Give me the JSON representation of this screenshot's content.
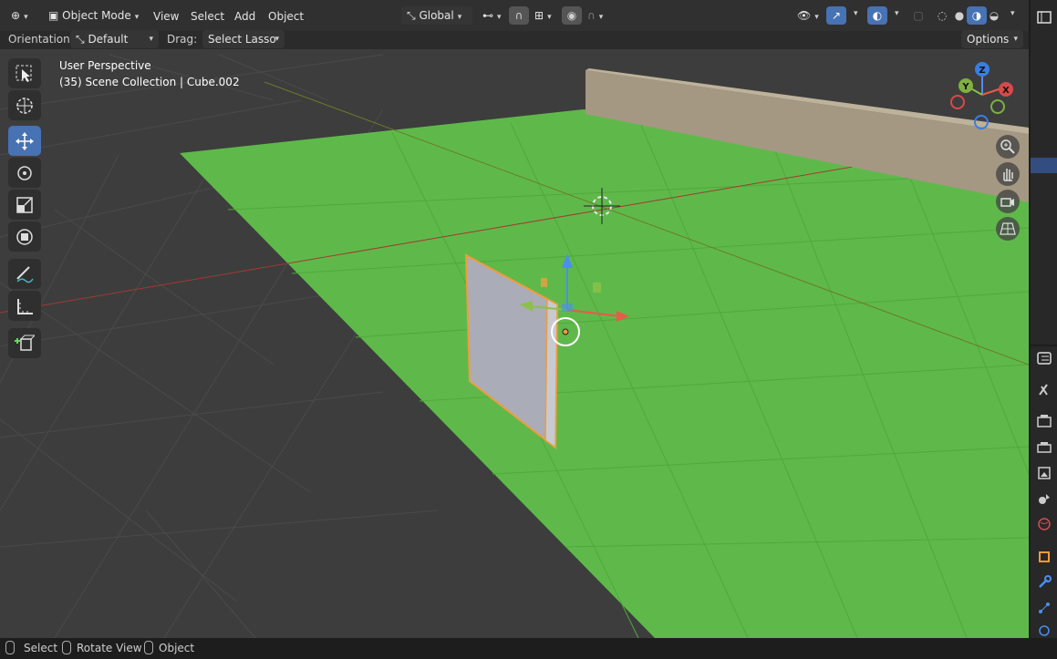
{
  "header": {
    "mode": "Object Mode",
    "menus": [
      "View",
      "Select",
      "Add",
      "Object"
    ],
    "transform_orientation": "Global"
  },
  "toolsettings": {
    "orientation_label": "Orientation:",
    "orientation_value": "Default",
    "drag_label": "Drag:",
    "drag_value": "Select Lasso",
    "options_label": "Options"
  },
  "viewport": {
    "view_name": "User Perspective",
    "collection_info": "(35) Scene Collection | Cube.002",
    "gizmo_axes": {
      "x": "X",
      "y": "Y",
      "z": "Z"
    }
  },
  "toolbar": {
    "tools": [
      "select-box",
      "cursor",
      "move",
      "rotate",
      "scale",
      "transform",
      "annotate",
      "measure",
      "add-cube"
    ],
    "active_tool": "move"
  },
  "statusbar": {
    "items": [
      "Select",
      "Rotate View",
      "Object"
    ]
  },
  "colors": {
    "accent": "#4772b3",
    "plane": "#5fb94a",
    "selection_outline": "#f29b3a"
  }
}
